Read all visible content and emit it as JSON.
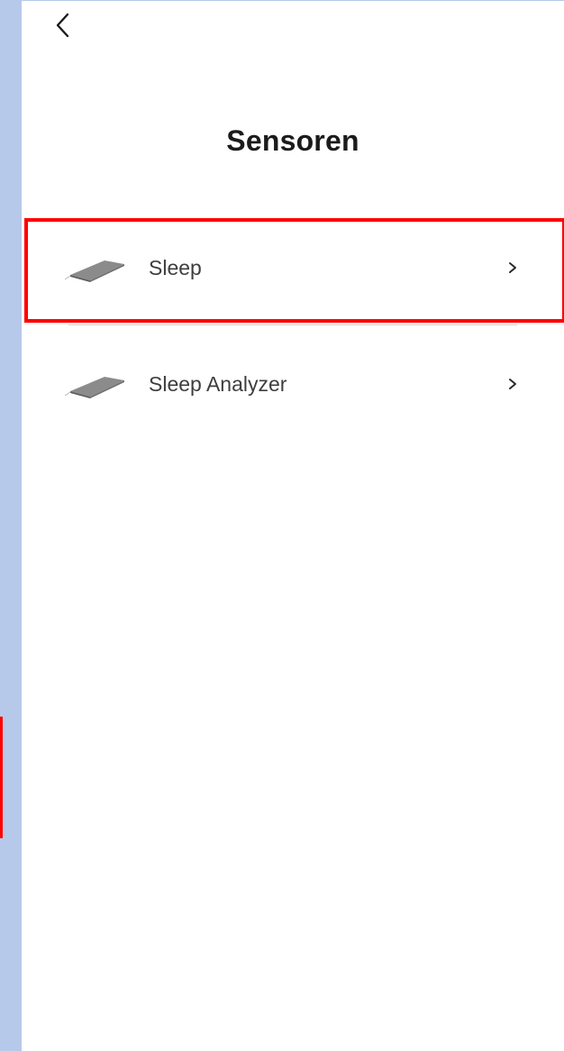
{
  "header": {
    "back_icon": "chevron-left-icon",
    "title": "Sensoren"
  },
  "sensors": {
    "items": [
      {
        "label": "Sleep",
        "icon": "sleep-mat-icon",
        "chevron": "chevron-right-icon",
        "highlighted": true
      },
      {
        "label": "Sleep Analyzer",
        "icon": "sleep-mat-icon",
        "chevron": "chevron-right-icon",
        "highlighted": false
      }
    ]
  },
  "colors": {
    "highlight": "#ff0000",
    "left_strip": "#b6c9ea",
    "title_text": "#1b1b1b",
    "item_text": "#3e3e3e",
    "divider": "#d9d9d9"
  }
}
